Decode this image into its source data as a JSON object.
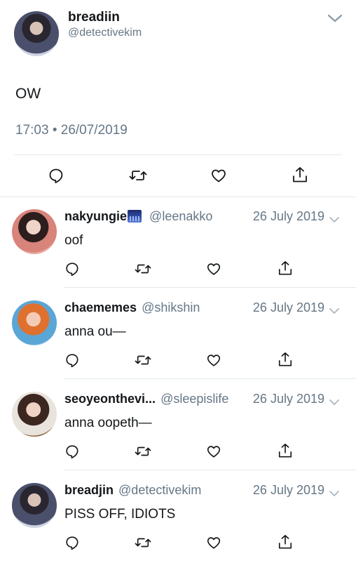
{
  "tweet": {
    "display_name": "breadiin",
    "handle": "@detectivekim",
    "text": "OW",
    "timestamp": "17:03 • 26/07/2019",
    "actions": [
      "reply-icon",
      "retweet-icon",
      "like-icon",
      "share-icon"
    ]
  },
  "replies": [
    {
      "display_name": "nakyungie",
      "emoji": "night-city-emoji",
      "handle": "@leenakko",
      "date": "26 July 2019",
      "text": "oof"
    },
    {
      "display_name": "chaememes",
      "handle": "@shikshin",
      "date": "26 July 2019",
      "text": "anna ou—"
    },
    {
      "display_name": "seoyeonthevi...",
      "handle": "@sleepislife",
      "date": "26 July 2019",
      "text": "anna oopeth—"
    },
    {
      "display_name": "breadjin",
      "handle": "@detectivekim",
      "date": "26 July 2019",
      "text": "PISS OFF, IDIOTS"
    }
  ],
  "colors": {
    "text": "#14171a",
    "secondary": "#657786",
    "divider": "#e1e8ed"
  }
}
